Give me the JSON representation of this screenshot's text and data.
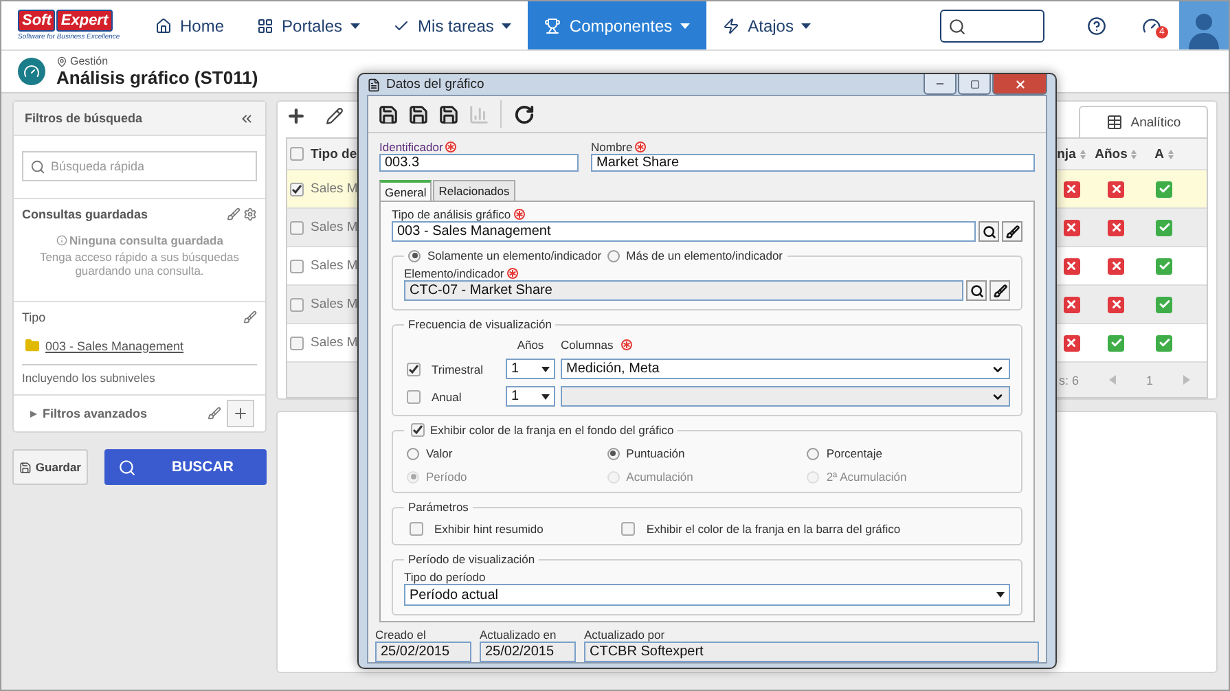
{
  "logo": {
    "name_part_1": "Soft",
    "name_part_2": "Expert",
    "tagline": "Software for Business Excellence"
  },
  "nav": [
    {
      "label": "Home",
      "dropdown": false,
      "selected": false
    },
    {
      "label": "Portales",
      "dropdown": true,
      "selected": false
    },
    {
      "label": "Mis tareas",
      "dropdown": true,
      "selected": false
    },
    {
      "label": "Componentes",
      "dropdown": true,
      "selected": true
    },
    {
      "label": "Atajos",
      "dropdown": true,
      "selected": false
    }
  ],
  "notifications": {
    "count": "4"
  },
  "breadcrumb": "Gestión",
  "page_title": "Análisis gráfico (ST011)",
  "filters": {
    "title": "Filtros de búsqueda",
    "search": {
      "placeholder": "Búsqueda rápida"
    },
    "saved_queries": {
      "title": "Consultas guardadas",
      "empty_title": "Ninguna consulta guardada",
      "empty_text": "Tenga acceso rápido a sus búsquedas guardando una consulta."
    },
    "type": {
      "title": "Tipo",
      "item": "003 - Sales Management",
      "note": "Incluyendo los subniveles"
    },
    "advanced": {
      "label": "Filtros avanzados",
      "expanded": false
    }
  },
  "buttons": {
    "save": "Guardar",
    "search": "BUSCAR"
  },
  "grid": {
    "view_tab": "Analítico",
    "header_checked": false,
    "columns": [
      "Tipo de",
      "nja",
      "Años",
      "A"
    ],
    "rows": [
      {
        "selected": true,
        "checked": true,
        "text": "Sales M",
        "flags": [
          false,
          false,
          true
        ]
      },
      {
        "selected": false,
        "checked": false,
        "text": "Sales M",
        "flags": [
          false,
          false,
          true
        ]
      },
      {
        "selected": false,
        "checked": false,
        "text": "Sales M",
        "flags": [
          false,
          false,
          true
        ]
      },
      {
        "selected": false,
        "checked": false,
        "text": "Sales M",
        "flags": [
          false,
          false,
          true
        ]
      },
      {
        "selected": false,
        "checked": false,
        "text": "Sales M",
        "flags": [
          false,
          true,
          true
        ]
      }
    ],
    "footer": {
      "count": "s: 6",
      "page": "1"
    }
  },
  "dialog": {
    "title": "Datos del gráfico",
    "toolbar": [
      {
        "disabled": false
      },
      {
        "disabled": false
      },
      {
        "disabled": false
      },
      {
        "disabled": true
      },
      {
        "disabled": false
      }
    ],
    "identifier": {
      "label": "Identificador",
      "required": true,
      "value": "003.3"
    },
    "name": {
      "label": "Nombre",
      "required": true,
      "value": "Market Share"
    },
    "tabs": [
      {
        "label": "General",
        "selected": true
      },
      {
        "label": "Relacionados",
        "selected": false
      }
    ],
    "chart_type": {
      "label": "Tipo de análisis gráfico",
      "required": true,
      "value": "003 - Sales Management"
    },
    "element_mode": [
      {
        "label": "Solamente un elemento/indicador",
        "selected": true
      },
      {
        "label": "Más de un elemento/indicador",
        "selected": false
      }
    ],
    "element": {
      "label": "Elemento/indicador",
      "required": true,
      "value": "CTC-07 - Market Share",
      "disabled": true
    },
    "frequency": {
      "title": "Frecuencia de visualización",
      "years_label": "Años",
      "columns_label": "Columnas",
      "columns_required": true,
      "rows": [
        {
          "label": "Trimestral",
          "checked": true,
          "years": "1",
          "columns": "Medición, Meta",
          "disabled": false
        },
        {
          "label": "Anual",
          "checked": false,
          "years": "1",
          "disabled": true
        }
      ]
    },
    "band_color": {
      "label": "Exhibir color de la franja en el fondo del gráfico",
      "checked": true,
      "options": [
        {
          "label": "Valor",
          "selected": false,
          "disabled": false
        },
        {
          "label": "Puntuación",
          "selected": true,
          "disabled": false
        },
        {
          "label": "Porcentaje",
          "selected": false,
          "disabled": false
        },
        {
          "label": "Período",
          "selected": true,
          "disabled": true
        },
        {
          "label": "Acumulación",
          "selected": false,
          "disabled": true
        },
        {
          "label": "2ª Acumulación",
          "selected": false,
          "disabled": true
        }
      ]
    },
    "parameters": {
      "title": "Parámetros",
      "options": [
        {
          "label": "Exhibir hint resumido",
          "checked": false
        },
        {
          "label": "Exhibir el color de la franja en la barra del gráfico",
          "checked": false
        }
      ]
    },
    "period": {
      "title": "Período de visualización",
      "type_label": "Tipo do período",
      "value": "Período actual"
    },
    "footer": [
      {
        "label": "Creado el",
        "value": "25/02/2015"
      },
      {
        "label": "Actualizado en",
        "value": "25/02/2015"
      },
      {
        "label": "Actualizado por",
        "value": "CTCBR Softexpert"
      }
    ]
  }
}
